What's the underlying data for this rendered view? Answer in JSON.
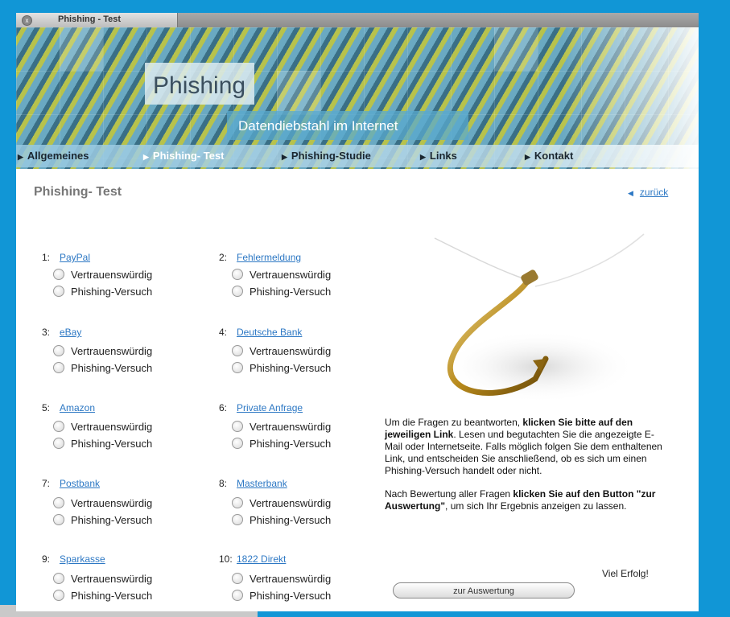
{
  "window": {
    "tab_title": "Phishing - Test",
    "close_glyph": "x"
  },
  "banner": {
    "logo": "Phishing",
    "subtitle": "Datendiebstahl im Internet"
  },
  "nav": {
    "items": [
      {
        "label": "Allgemeines"
      },
      {
        "label": "Phishing- Test"
      },
      {
        "label": "Phishing-Studie"
      },
      {
        "label": "Links"
      },
      {
        "label": "Kontakt"
      }
    ],
    "arrow_glyph": "▶"
  },
  "page": {
    "title": "Phishing- Test",
    "back_label": "zurück",
    "back_arrow": "◀"
  },
  "options": {
    "trust": "Vertrauenswürdig",
    "phish": "Phishing-Versuch"
  },
  "questions": [
    {
      "num": "1:",
      "label": "PayPal"
    },
    {
      "num": "2:",
      "label": "Fehlermeldung"
    },
    {
      "num": "3:",
      "label": "eBay"
    },
    {
      "num": "4:",
      "label": "Deutsche Bank"
    },
    {
      "num": "5:",
      "label": "Amazon"
    },
    {
      "num": "6:",
      "label": "Private Anfrage"
    },
    {
      "num": "7:",
      "label": "Postbank"
    },
    {
      "num": "8:",
      "label": "Masterbank"
    },
    {
      "num": "9:",
      "label": "Sparkasse"
    },
    {
      "num": "10:",
      "label": "1822 Direkt"
    }
  ],
  "info": {
    "p1_a": "Um die Fragen zu beantworten, ",
    "p1_b": "klicken Sie bitte auf den jeweiligen Link",
    "p1_c": ". Lesen und begutachten Sie die angezeigte E-Mail oder Internetseite. Falls möglich folgen Sie dem enthaltenen Link, und entscheiden Sie anschließend, ob es sich um einen Phishing-Versuch handelt oder nicht.",
    "p2_a": "Nach Bewertung aller Fragen ",
    "p2_b": "klicken Sie auf den Button \"zur Auswertung\"",
    "p2_c": ", um sich Ihr Ergebnis anzeigen zu lassen."
  },
  "good_luck": "Viel Erfolg!",
  "eval_button": "zur Auswertung",
  "colors": {
    "frame": "#1196d6",
    "link": "#2d78c4",
    "title": "#777777"
  }
}
